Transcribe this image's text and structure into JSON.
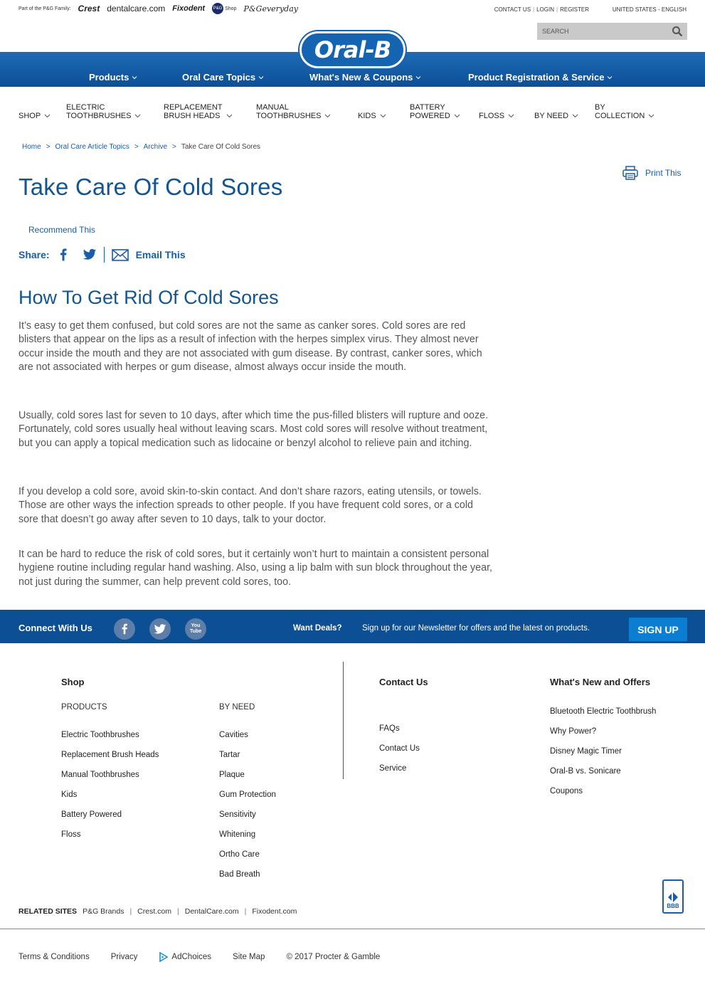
{
  "pg_family": {
    "intro": "Part of the P&G Family:",
    "brands": [
      "Crest",
      "dentalcare.com",
      "Fixodent",
      "Shop",
      "P&Geveryday"
    ],
    "pg_badge": "P&G"
  },
  "utility": {
    "contact": "CONTACT US",
    "login": "LOGIN",
    "register": "REGISTER",
    "locale": "UNITED STATES - ENGLISH",
    "search_placeholder": "SEARCH"
  },
  "logo": "Oral-B",
  "main_nav": [
    "Products",
    "Oral Care Topics",
    "What's New & Coupons",
    "Product Registration & Service"
  ],
  "categories": [
    {
      "line1": "",
      "line2": "SHOP"
    },
    {
      "line1": "ELECTRIC",
      "line2": "TOOTHBRUSHES"
    },
    {
      "line1": "REPLACEMENT",
      "line2": "BRUSH HEADS"
    },
    {
      "line1": "MANUAL",
      "line2": "TOOTHBRUSHES"
    },
    {
      "line1": "",
      "line2": "KIDS"
    },
    {
      "line1": "BATTERY",
      "line2": "POWERED"
    },
    {
      "line1": "",
      "line2": "FLOSS"
    },
    {
      "line1": "",
      "line2": "BY NEED"
    },
    {
      "line1": "BY",
      "line2": "COLLECTION"
    }
  ],
  "breadcrumb": [
    "Home",
    "Oral Care Article Topics",
    "Archive",
    "Take Care Of Cold Sores"
  ],
  "breadcrumb_sep": ">",
  "print_label": "Print This",
  "title": "Take Care Of Cold Sores",
  "recommend": "Recommend This",
  "share": {
    "label": "Share:",
    "email": "Email This"
  },
  "section_title": "How To Get Rid Of Cold Sores",
  "paragraphs": [
    "It’s easy to get them confused, but cold sores are not the same as canker sores. Cold sores are red blisters that appear on the lips as a result of infection with the herpes simplex virus. They almost never occur inside the mouth and they are not associated with gum disease. By contrast, canker sores, which are not associated with herpes or gum disease, almost always occur inside the mouth.",
    "Usually, cold sores last for seven to 10 days, after which time the pus-filled blisters will rupture and ooze. Fortunately, cold sores usually heal without leaving scars. Most cold sores will resolve without treatment, but you can apply a topical medication such as lidocaine or benzyl alcohol to relieve pain and itching.",
    "If you develop a cold sore, avoid skin-to-skin contact. And don’t share razors, eating utensils, or towels. Those are other ways the infection spreads to other people. If you have frequent cold sores, or a cold sore that doesn’t go away after seven to 10 days, talk to your doctor.",
    "It can be hard to reduce the risk of cold sores, but it certainly won’t hurt to maintain a consistent personal hygiene routine including regular hand washing. Also, using a lip balm with sun block throughout the year, not just during the summer, can help prevent cold sores, too."
  ],
  "connect": {
    "title": "Connect With Us",
    "deals": "Want Deals?",
    "newsletter": "Sign up for our Newsletter for offers and the latest on products.",
    "signup": "SIGN UP",
    "youtube_top": "You",
    "youtube_bottom": "Tube"
  },
  "footer": {
    "shop_head": "Shop",
    "products_head": "PRODUCTS",
    "products": [
      "Electric Toothbrushes",
      "Replacement Brush Heads",
      "Manual Toothbrushes",
      "Kids",
      "Battery Powered",
      "Floss"
    ],
    "byneed_head": "BY NEED",
    "byneed": [
      "Cavities",
      "Tartar",
      "Plaque",
      "Gum Protection",
      "Sensitivity",
      "Whitening",
      "Ortho Care",
      "Bad Breath"
    ],
    "contact_head": "Contact Us",
    "contact": [
      "FAQs",
      "Contact Us",
      "Service"
    ],
    "whatsnew_head": "What's New and Offers",
    "whatsnew": [
      "Bluetooth Electric Toothbrush",
      "Why Power?",
      "Disney Magic Timer",
      "Oral-B vs. Sonicare",
      "Coupons"
    ]
  },
  "bbb_label": "BBB",
  "related": {
    "head": "RELATED SITES",
    "links": [
      "P&G Brands",
      "Crest.com",
      "DentalCare.com",
      "Fixodent.com"
    ],
    "sep": "|"
  },
  "bottom": {
    "terms": "Terms & Conditions",
    "privacy": "Privacy",
    "adchoices": "AdChoices",
    "sitemap": "Site Map",
    "copyright": "© 2017 Procter & Gamble"
  },
  "colors": {
    "brand_blue": "#0d4f95",
    "link_blue": "#1a5da8",
    "title_blue": "#13558f",
    "signup_blue": "#0b7ed1"
  }
}
